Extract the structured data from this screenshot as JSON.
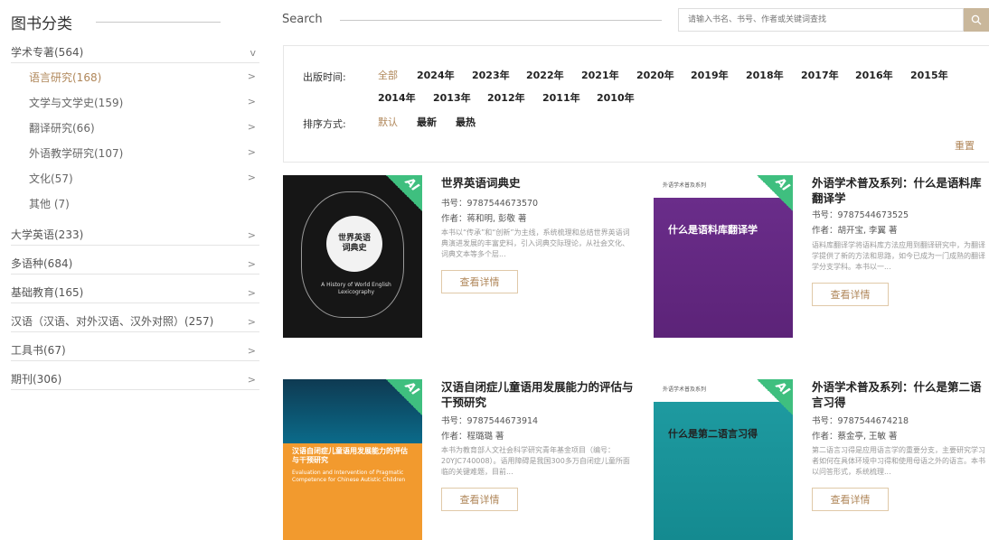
{
  "sidebar": {
    "title": "图书分类",
    "categories": [
      {
        "label": "学术专著(564)",
        "arrow": "v"
      },
      {
        "label": "语言研究(168)",
        "arrow": ">"
      },
      {
        "label": "文学与文学史(159)",
        "arrow": ">"
      },
      {
        "label": "翻译研究(66)",
        "arrow": ">"
      },
      {
        "label": "外语教学研究(107)",
        "arrow": ">"
      },
      {
        "label": "文化(57)",
        "arrow": ">"
      },
      {
        "label": "其他 (7)",
        "arrow": ""
      },
      {
        "label": "大学英语(233)",
        "arrow": ">"
      },
      {
        "label": "多语种(684)",
        "arrow": ">"
      },
      {
        "label": "基础教育(165)",
        "arrow": ">"
      },
      {
        "label": "汉语（汉语、对外汉语、汉外对照）(257)",
        "arrow": ">"
      },
      {
        "label": "工具书(67)",
        "arrow": ">"
      },
      {
        "label": "期刊(306)",
        "arrow": ">"
      }
    ]
  },
  "search": {
    "label": "Search",
    "placeholder": "请输入书名、书号、作者或关键词查找"
  },
  "filters": {
    "time_label": "出版时间:",
    "years": [
      "全部",
      "2024年",
      "2023年",
      "2022年",
      "2021年",
      "2020年",
      "2019年",
      "2018年",
      "2017年",
      "2016年",
      "2015年",
      "2014年",
      "2013年",
      "2012年",
      "2011年",
      "2010年"
    ],
    "sort_label": "排序方式:",
    "sorts": [
      "默认",
      "最新",
      "最热"
    ],
    "reset": "重置"
  },
  "books": [
    {
      "title": "世界英语词典史",
      "isbn": "书号：9787544673570",
      "author": "作者：蒋和明, 彭敬 著",
      "desc": "本书以“传承”和“创新”为主线，系统梳理和总结世界英语词典演进发展的丰富史料，引入词典交际理论，从社会文化、词典文本等多个层...",
      "button": "查看详情",
      "cover_title": "世界英语\n词典史",
      "cover_en": "A History of World English Lexicography",
      "ai": "AI"
    },
    {
      "title": "外语学术普及系列：什么是语料库翻译学",
      "isbn": "书号：9787544673525",
      "author": "作者：胡开宝, 李翼 著",
      "desc": "语料库翻译学将语料库方法应用到翻译研究中，为翻译学提供了新的方法和思路，如今已成为一门成熟的翻译学分支学科。本书以一...",
      "button": "查看详情",
      "cover_series": "外语学术普及系列",
      "cover_title": "什么是语料库翻译学",
      "ai": "AI"
    },
    {
      "title": "汉语自闭症儿童语用发展能力的评估与干预研究",
      "isbn": "书号：9787544673914",
      "author": "作者：程璐璐 著",
      "desc": "本书为教育部人文社会科学研究青年基金项目（编号：20YJC740008）。语用障碍是我国300多万自闭症儿童所面临的关键难题，目前...",
      "button": "查看详情",
      "cover_title": "汉语自闭症儿童语用发展能力的评估与干预研究",
      "cover_en": "Evaluation and Intervention of Pragmatic Competence for Chinese Autistic Children",
      "ai": "AI"
    },
    {
      "title": "外语学术普及系列：什么是第二语言习得",
      "isbn": "书号：9787544674218",
      "author": "作者：蔡金亭, 王敏 著",
      "desc": "第二语言习得是应用语言学的重要分支，主要研究学习者如何在具体环境中习得和使用母语之外的语言。本书以问答形式，系统梳理...",
      "button": "查看详情",
      "cover_series": "外语学术普及系列",
      "cover_title": "什么是第二语言习得",
      "ai": "AI"
    }
  ]
}
